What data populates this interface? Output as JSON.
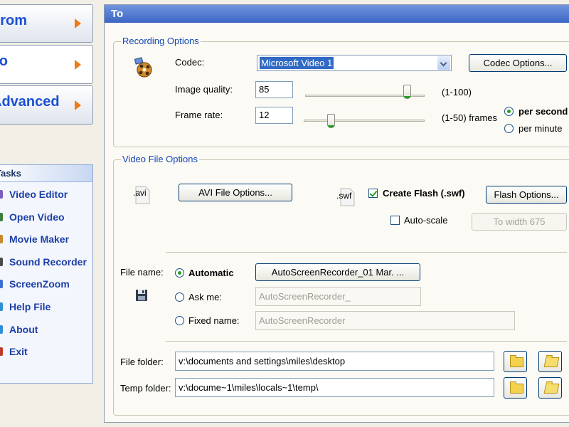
{
  "nav": {
    "from_label": "From",
    "to_label": "To",
    "advanced_label": "Advanced"
  },
  "tasks": {
    "header": "Tasks",
    "items": [
      {
        "label": "Video Editor",
        "icon": "video-editor-icon",
        "color": "#7a5fc0"
      },
      {
        "label": "Open Video",
        "icon": "open-video-icon",
        "color": "#3a7f3a"
      },
      {
        "label": "Movie Maker",
        "icon": "movie-maker-icon",
        "color": "#c88a2a"
      },
      {
        "label": "Sound Recorder",
        "icon": "sound-recorder-icon",
        "color": "#4a4a4a"
      },
      {
        "label": "ScreenZoom",
        "icon": "screenzoom-icon",
        "color": "#3b6fd1"
      },
      {
        "label": "Help File",
        "icon": "help-file-icon",
        "color": "#2f8fd6"
      },
      {
        "label": "About",
        "icon": "about-icon",
        "color": "#2f8fd6"
      },
      {
        "label": "Exit",
        "icon": "exit-icon",
        "color": "#c0392b"
      }
    ]
  },
  "panel": {
    "title": "To"
  },
  "recording": {
    "group_title": "Recording Options",
    "codec_label": "Codec:",
    "codec_value": "Microsoft Video 1",
    "codec_options_button": "Codec Options...",
    "quality_label": "Image quality:",
    "quality_value": "85",
    "quality_range": "(1-100)",
    "quality_level": 85,
    "framerate_label": "Frame rate:",
    "framerate_value": "12",
    "framerate_range": "(1-50) frames",
    "framerate_level": 12,
    "per_second_label": "per second",
    "per_minute_label": "per minute"
  },
  "video_file": {
    "group_title": "Video File Options",
    "avi_icon_text": ".avi",
    "avi_button": "AVI File Options...",
    "swf_icon_text": ".swf",
    "create_flash_label": "Create Flash  (.swf)",
    "flash_options_button": "Flash Options...",
    "autoscale_label": "Auto-scale",
    "to_width_button": "To width 675",
    "file_name_label": "File name:",
    "automatic_label": "Automatic",
    "automatic_value": "AutoScreenRecorder_01 Mar. ...",
    "ask_me_label": "Ask me:",
    "ask_me_value": "AutoScreenRecorder_",
    "fixed_name_label": "Fixed name:",
    "fixed_name_value": "AutoScreenRecorder",
    "file_folder_label": "File folder:",
    "file_folder_value": "v:\\documents and settings\\miles\\desktop",
    "temp_folder_label": "Temp folder:",
    "temp_folder_value": "v:\\docume~1\\miles\\locals~1\\temp\\"
  }
}
